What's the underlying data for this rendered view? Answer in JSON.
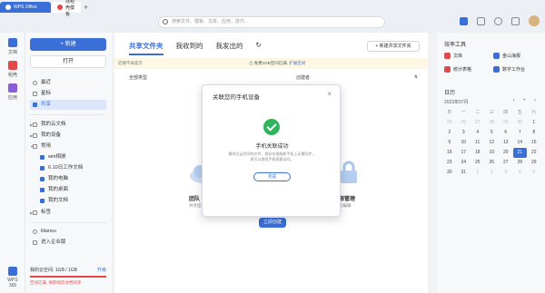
{
  "app": {
    "name": "WPS Office",
    "tabs": [
      {
        "label": "WPS Office"
      },
      {
        "label": "找稻壳模板"
      }
    ],
    "new_tab": "+"
  },
  "search": {
    "placeholder": "搜索文件、模板、文库、应用、技巧..."
  },
  "rail": [
    {
      "label": "文档"
    },
    {
      "label": "稻壳"
    },
    {
      "label": "应用"
    }
  ],
  "rail_bottom": "WPS 365",
  "sidebar": {
    "new_label": "+ 新建",
    "open_label": "打开",
    "nav": [
      {
        "label": "最近"
      },
      {
        "label": "星标"
      },
      {
        "label": "共享"
      }
    ],
    "tree": [
      {
        "label": "我的云文档"
      },
      {
        "label": "我的设备"
      },
      {
        "label": "常用"
      },
      {
        "label": "wm相册"
      },
      {
        "label": "6.10日工作文档"
      },
      {
        "label": "我的电脑"
      },
      {
        "label": "我的桌面"
      },
      {
        "label": "我的文档"
      },
      {
        "label": "标签"
      }
    ],
    "user": "lilianxu",
    "join": "进入企业版",
    "storage_label": "我的云空间: 1GB / 1GB",
    "upgrade": "升级",
    "warning": "空间已满, 将影响云文档同步"
  },
  "main": {
    "tabs": [
      {
        "label": "共享文件夹"
      },
      {
        "label": "我收到的"
      },
      {
        "label": "我发出的"
      }
    ],
    "new_share_button": "+ 新建共享文件夹",
    "notice_left": "近期不再提示",
    "notice_center": "免费1GB空间已满.",
    "notice_link": "扩展空间",
    "filter_type": "全部类型",
    "filter_owner": "创建者",
    "illus_left_title": "团队",
    "illus_left_sub": "共享团",
    "illus_right_title": "限管理",
    "illus_right_sub": "的编辑",
    "create_button": "立即创建"
  },
  "modal": {
    "title": "关联您的手机设备",
    "heading": "手机关联成功",
    "desc": "最终近云空间的文件、保存在电脑和手机上无需同步，即可以使用手机随意访问。",
    "ok": "完成"
  },
  "right": {
    "tools_title": "效率工具",
    "tools": [
      {
        "label": "文库",
        "color": "#e54848"
      },
      {
        "label": "金山海报",
        "color": "#3a6fd8"
      },
      {
        "label": "统计表格",
        "color": "#e54848"
      },
      {
        "label": "数字工作台",
        "color": "#3a6fd8"
      }
    ],
    "calendar_title": "日历",
    "calendar_month": "2023年07月",
    "calendar_nav": "‹ • ›",
    "weekdays": [
      "日",
      "一",
      "二",
      "三",
      "四",
      "五",
      "六"
    ],
    "weeks": [
      [
        "25",
        "26",
        "27",
        "28",
        "29",
        "30",
        "1"
      ],
      [
        "2",
        "3",
        "4",
        "5",
        "6",
        "7",
        "8"
      ],
      [
        "9",
        "10",
        "11",
        "12",
        "13",
        "14",
        "15"
      ],
      [
        "16",
        "17",
        "18",
        "19",
        "20",
        "21",
        "22"
      ],
      [
        "23",
        "24",
        "25",
        "26",
        "27",
        "28",
        "29"
      ],
      [
        "30",
        "31",
        "1",
        "2",
        "3",
        "4",
        "5"
      ]
    ],
    "today": "21"
  }
}
